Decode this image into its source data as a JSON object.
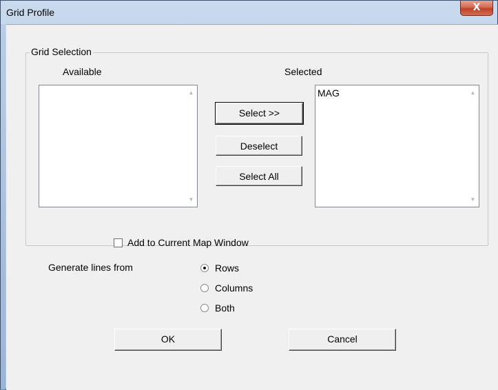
{
  "window": {
    "title": "Grid Profile",
    "close_glyph": "X"
  },
  "grid_selection": {
    "group_title": "Grid Selection",
    "available_label": "Available",
    "selected_label": "Selected",
    "available_items": [],
    "selected_items": [
      "MAG"
    ],
    "buttons": {
      "select": "Select >>",
      "deselect": "Deselect",
      "select_all": "Select All"
    }
  },
  "add_to_map": {
    "label": "Add to Current Map Window",
    "checked": false
  },
  "generate_lines": {
    "label": "Generate lines from",
    "options": [
      {
        "label": "Rows",
        "selected": true
      },
      {
        "label": "Columns",
        "selected": false
      },
      {
        "label": "Both",
        "selected": false
      }
    ]
  },
  "footer": {
    "ok": "OK",
    "cancel": "Cancel"
  },
  "colors": {
    "title_bar": "#b7cbe4",
    "close_button": "#c0402a",
    "client_bg": "#f0f0f0"
  }
}
